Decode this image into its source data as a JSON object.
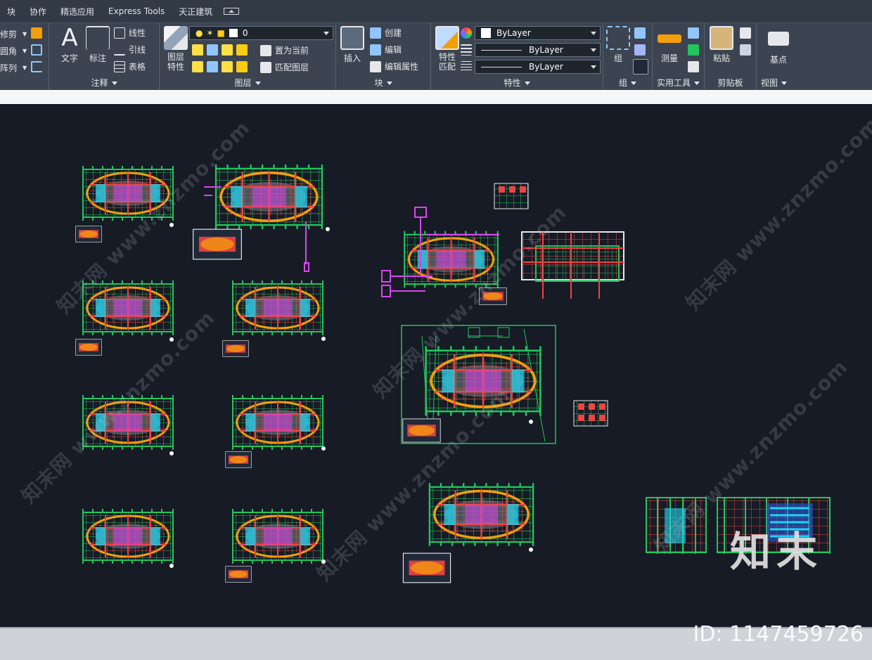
{
  "tabs": [
    "块",
    "协作",
    "精选应用",
    "Express Tools",
    "天正建筑"
  ],
  "ribbon": {
    "modify": {
      "items": [
        "修剪",
        "圆角",
        "阵列"
      ]
    },
    "annotation": {
      "title": "注释",
      "text_label": "文字",
      "dimension_label": "标注",
      "linear_label": "线性",
      "leader_label": "引线",
      "table_label": "表格"
    },
    "layers": {
      "title": "图层",
      "properties_label": "图层\n特性",
      "current_layer": "0",
      "set_current_label": "置为当前",
      "match_layer_label": "匹配图层"
    },
    "block": {
      "title": "块",
      "insert_label": "插入",
      "create_label": "创建",
      "edit_label": "编辑",
      "edit_attributes_label": "编辑属性"
    },
    "properties": {
      "title": "特性",
      "match_label": "特性\n匹配",
      "color_value": "ByLayer",
      "linetype_value": "ByLayer",
      "lineweight_value": "ByLayer"
    },
    "groups": {
      "title": "组",
      "group_label": "组"
    },
    "utilities": {
      "title": "实用工具",
      "measure_label": "测量"
    },
    "clipboard": {
      "title": "剪贴板",
      "paste_label": "粘贴"
    },
    "view": {
      "title": "视图",
      "base_label": "基点"
    }
  },
  "watermark": {
    "text": "知末网 www.znzmo.com",
    "brand": "知末",
    "id": "ID: 1147459726"
  },
  "colors": {
    "canvas": "#171b25",
    "cad_green": "#22c55e",
    "cad_red": "#ef4444",
    "cad_magenta": "#d946ef",
    "cad_cyan": "#22d3ee",
    "cad_yellow": "#fde047"
  }
}
